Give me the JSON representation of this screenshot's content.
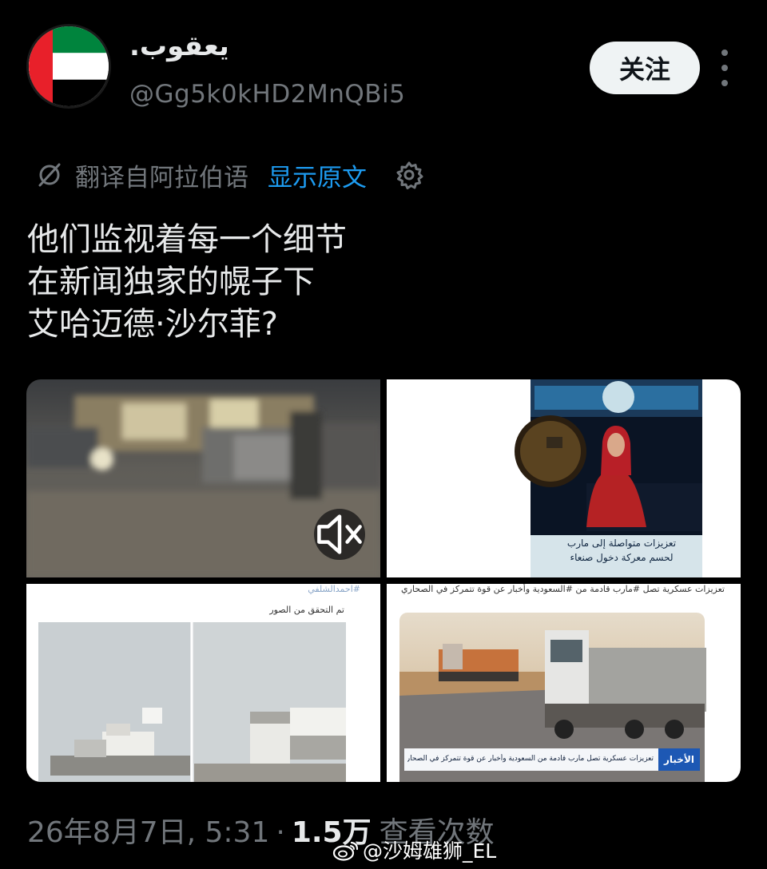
{
  "author": {
    "display_name": "يعقوب.",
    "handle": "@Gg5k0kHD2MnQBi5",
    "avatar_icon": "uae-flag-icon"
  },
  "actions": {
    "follow_label": "关注",
    "more_icon": "more-vertical-icon"
  },
  "translation": {
    "translated_from": "翻译自阿拉伯语",
    "show_original": "显示原文",
    "link_color": "#1d9bf0"
  },
  "tweet": {
    "lines": [
      "他们监视着每一个细节",
      "在新闻独家的幌子下",
      "艾哈迈德·沙尔菲?"
    ]
  },
  "media": {
    "image2": {
      "caption_line1": "تعزيزات متواصلة إلى مارب",
      "caption_line2": "لحسم معركة دخول صنعاء"
    },
    "image3": {
      "header_text": "#احمدالشلفي",
      "verified_text": "تم التحقق من الصور"
    },
    "image4": {
      "post_text": "تعزيزات عسكرية تصل #مارب قادمة من #السعودية وأخبار عن قوة تتمركز في الصحاري",
      "banner_text": "تعزيزات عسكرية تصل مارب قادمة من السعودية وأخبار عن قوة تتمركز في الصحاري",
      "banner_label": "الأخبار"
    }
  },
  "footer": {
    "timestamp": "26年8月7日, 5:31",
    "separator": "·",
    "views_count": "1.5万",
    "views_label": "查看次数"
  },
  "watermark": {
    "text": "@沙姆雄狮_EL",
    "icon": "weibo-icon"
  }
}
